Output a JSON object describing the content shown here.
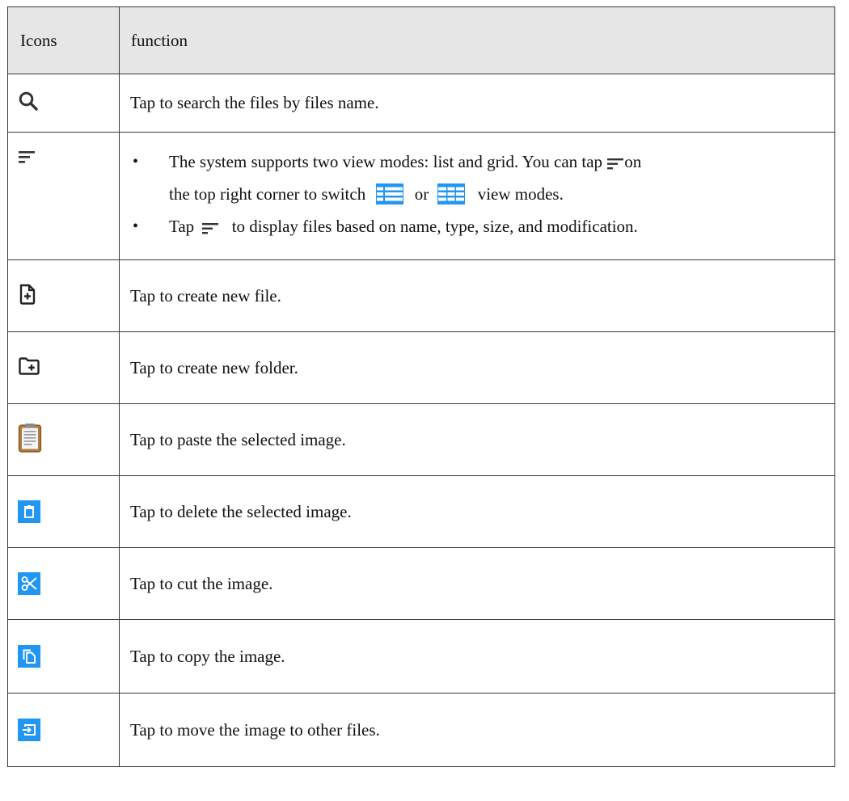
{
  "header": {
    "icons_col": "Icons",
    "function_col": "function"
  },
  "rows": [
    {
      "icon": "search-icon",
      "text": "Tap to search the files by files name."
    },
    {
      "icon": "sort-icon",
      "bullets": {
        "b1_part1": "The system supports two view modes: list and grid. You can tap",
        "b1_part2": "on",
        "b1_line2_part1": "the top right corner to switch",
        "b1_line2_or": "or",
        "b1_line2_part2": "view modes.",
        "b2_part1": "Tap",
        "b2_part2": "to display files based on name, type, size, and modification."
      }
    },
    {
      "icon": "new-file-icon",
      "text": "Tap to create new file."
    },
    {
      "icon": "new-folder-icon",
      "text": "Tap to create new folder."
    },
    {
      "icon": "clipboard-icon",
      "text": "Tap to paste the selected image."
    },
    {
      "icon": "trash-icon",
      "text": "Tap to delete the selected image."
    },
    {
      "icon": "scissors-icon",
      "text": "Tap to cut the image."
    },
    {
      "icon": "copy-icon",
      "text": "Tap to copy the image."
    },
    {
      "icon": "move-icon",
      "text": "Tap to move the image to other files."
    }
  ],
  "colors": {
    "header_bg": "#e6e6e6",
    "accent_blue": "#2196f3",
    "clipboard_brown": "#b07a3a"
  }
}
